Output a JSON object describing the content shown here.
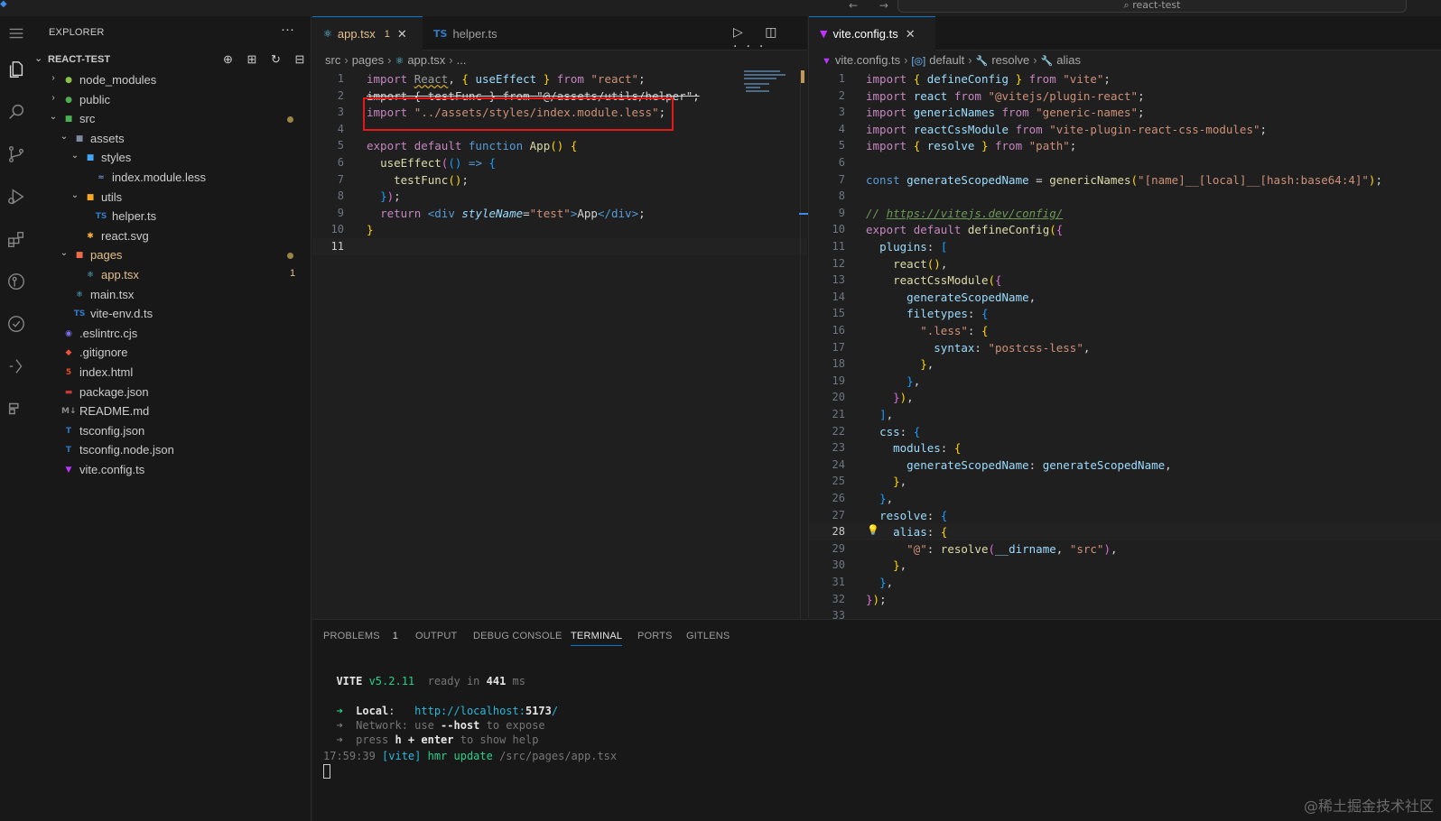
{
  "window": {
    "search_label": "react-test",
    "nav_arrows": "← →"
  },
  "activity_bar": {
    "items": [
      "explorer-icon",
      "search-icon",
      "source-control-icon",
      "run-debug-icon",
      "extensions-icon",
      "gitlens-icon",
      "remote-icon",
      "testing-icon",
      "timeline-icon"
    ]
  },
  "explorer": {
    "title": "EXPLORER",
    "more": "···",
    "project": "REACT-TEST",
    "actions": "⊕ ⊞ ↻ ⊟",
    "tree": [
      {
        "name": "node_modules",
        "depth": 0,
        "type": "folder",
        "open": false,
        "icon": "node-folder-icon"
      },
      {
        "name": "public",
        "depth": 0,
        "type": "folder",
        "open": false,
        "icon": "public-folder-icon"
      },
      {
        "name": "src",
        "depth": 0,
        "type": "folder",
        "open": true,
        "icon": "src-folder-icon",
        "dot": true
      },
      {
        "name": "assets",
        "depth": 1,
        "type": "folder",
        "open": true,
        "icon": "assets-folder-icon"
      },
      {
        "name": "styles",
        "depth": 2,
        "type": "folder",
        "open": true,
        "icon": "styles-folder-icon"
      },
      {
        "name": "index.module.less",
        "depth": 3,
        "type": "file",
        "icon": "less-file-icon"
      },
      {
        "name": "utils",
        "depth": 2,
        "type": "folder",
        "open": true,
        "icon": "utils-folder-icon"
      },
      {
        "name": "helper.ts",
        "depth": 3,
        "type": "file",
        "icon": "ts-file-icon"
      },
      {
        "name": "react.svg",
        "depth": 2,
        "type": "file",
        "icon": "svg-file-icon"
      },
      {
        "name": "pages",
        "depth": 1,
        "type": "folder",
        "open": true,
        "icon": "pages-folder-icon",
        "dot": true,
        "modified": true
      },
      {
        "name": "app.tsx",
        "depth": 2,
        "type": "file",
        "icon": "react-file-icon",
        "badge": "1",
        "modified": true
      },
      {
        "name": "main.tsx",
        "depth": 1,
        "type": "file",
        "icon": "react-file-icon"
      },
      {
        "name": "vite-env.d.ts",
        "depth": 1,
        "type": "file",
        "icon": "ts-file-icon"
      },
      {
        "name": ".eslintrc.cjs",
        "depth": 0,
        "type": "file",
        "icon": "eslint-file-icon"
      },
      {
        "name": ".gitignore",
        "depth": 0,
        "type": "file",
        "icon": "git-file-icon"
      },
      {
        "name": "index.html",
        "depth": 0,
        "type": "file",
        "icon": "html-file-icon"
      },
      {
        "name": "package.json",
        "depth": 0,
        "type": "file",
        "icon": "npm-file-icon"
      },
      {
        "name": "README.md",
        "depth": 0,
        "type": "file",
        "icon": "markdown-file-icon"
      },
      {
        "name": "tsconfig.json",
        "depth": 0,
        "type": "file",
        "icon": "tsconfig-file-icon"
      },
      {
        "name": "tsconfig.node.json",
        "depth": 0,
        "type": "file",
        "icon": "tsconfig-file-icon"
      },
      {
        "name": "vite.config.ts",
        "depth": 0,
        "type": "file",
        "icon": "vite-file-icon"
      }
    ]
  },
  "editor_left": {
    "tabs": [
      {
        "label": "app.tsx",
        "badge": "1",
        "close": "✕",
        "active": true,
        "icon": "react-file-icon"
      },
      {
        "label": "helper.ts",
        "active": false,
        "icon": "ts-file-icon"
      }
    ],
    "actions": "▷ ◫ ···",
    "breadcrumb": [
      "src",
      "pages",
      "app.tsx",
      "..."
    ],
    "code": [
      [
        [
          "kc",
          "import "
        ],
        [
          "unused",
          "React"
        ],
        [
          "p",
          ", "
        ],
        [
          "br1",
          "{"
        ],
        [
          "v",
          " useEffect "
        ],
        [
          "br1",
          "}"
        ],
        [
          "kc",
          " from "
        ],
        [
          "s",
          "\"react\""
        ],
        [
          "p",
          ";"
        ]
      ],
      [
        [
          "strike",
          "import { testFunc } from \"@/assets/utils/helper\";"
        ]
      ],
      [
        [
          "kc",
          "import "
        ],
        [
          "s",
          "\"../assets/styles/index.module.less\""
        ],
        [
          "p",
          ";"
        ]
      ],
      [],
      [
        [
          "kc",
          "export "
        ],
        [
          "kc",
          "default "
        ],
        [
          "k",
          "function "
        ],
        [
          "f",
          "App"
        ],
        [
          "br1",
          "()"
        ],
        [
          "p",
          " "
        ],
        [
          "br1",
          "{"
        ]
      ],
      [
        [
          "p",
          "  "
        ],
        [
          "f",
          "useEffect"
        ],
        [
          "br2",
          "("
        ],
        [
          "br3",
          "()"
        ],
        [
          "k",
          " => "
        ],
        [
          "br3",
          "{"
        ]
      ],
      [
        [
          "p",
          "    "
        ],
        [
          "f",
          "testFunc"
        ],
        [
          "br1",
          "()"
        ],
        [
          "p",
          ";"
        ]
      ],
      [
        [
          "p",
          "  "
        ],
        [
          "br3",
          "}"
        ],
        [
          "br2",
          ")"
        ],
        [
          "p",
          ";"
        ]
      ],
      [
        [
          "p",
          "  "
        ],
        [
          "kc",
          "return "
        ],
        [
          "tg",
          "<"
        ],
        [
          "tg",
          "div "
        ],
        [
          "attr",
          "styleName"
        ],
        [
          "p",
          "="
        ],
        [
          "s",
          "\"test\""
        ],
        [
          "tg",
          ">"
        ],
        [
          "txt",
          "App"
        ],
        [
          "tg",
          "</"
        ],
        [
          "tg",
          "div"
        ],
        [
          "tg",
          ">"
        ],
        [
          "p",
          ";"
        ]
      ],
      [
        [
          "br1",
          "}"
        ]
      ],
      []
    ],
    "current_line": 11
  },
  "editor_right": {
    "tabs": [
      {
        "label": "vite.config.ts",
        "close": "✕",
        "active": true,
        "icon": "vite-file-icon"
      }
    ],
    "breadcrumb": [
      "vite.config.ts",
      "default",
      "resolve",
      "alias"
    ],
    "code": [
      [
        [
          "kc",
          "import "
        ],
        [
          "br1",
          "{"
        ],
        [
          "v",
          " defineConfig "
        ],
        [
          "br1",
          "}"
        ],
        [
          "kc",
          " from "
        ],
        [
          "s",
          "\"vite\""
        ],
        [
          "p",
          ";"
        ]
      ],
      [
        [
          "kc",
          "import "
        ],
        [
          "v",
          "react"
        ],
        [
          "kc",
          " from "
        ],
        [
          "s",
          "\"@vitejs/plugin-react\""
        ],
        [
          "p",
          ";"
        ]
      ],
      [
        [
          "kc",
          "import "
        ],
        [
          "v",
          "genericNames"
        ],
        [
          "kc",
          " from "
        ],
        [
          "s",
          "\"generic-names\""
        ],
        [
          "p",
          ";"
        ]
      ],
      [
        [
          "kc",
          "import "
        ],
        [
          "v",
          "reactCssModule"
        ],
        [
          "kc",
          " from "
        ],
        [
          "s",
          "\"vite-plugin-react-css-modules\""
        ],
        [
          "p",
          ";"
        ]
      ],
      [
        [
          "kc",
          "import "
        ],
        [
          "br1",
          "{"
        ],
        [
          "v",
          " resolve "
        ],
        [
          "br1",
          "}"
        ],
        [
          "kc",
          " from "
        ],
        [
          "s",
          "\"path\""
        ],
        [
          "p",
          ";"
        ]
      ],
      [],
      [
        [
          "k",
          "const "
        ],
        [
          "v",
          "generateScopedName"
        ],
        [
          "p",
          " = "
        ],
        [
          "f",
          "genericNames"
        ],
        [
          "br1",
          "("
        ],
        [
          "s",
          "\"[name]__[local]__[hash:base64:4]\""
        ],
        [
          "br1",
          ")"
        ],
        [
          "p",
          ";"
        ]
      ],
      [],
      [
        [
          "cm",
          "// "
        ],
        [
          "cml",
          "https://vitejs.dev/config/"
        ]
      ],
      [
        [
          "kc",
          "export "
        ],
        [
          "kc",
          "default "
        ],
        [
          "f",
          "defineConfig"
        ],
        [
          "br1",
          "("
        ],
        [
          "br2",
          "{"
        ]
      ],
      [
        [
          "p",
          "  "
        ],
        [
          "v",
          "plugins"
        ],
        [
          "p",
          ": "
        ],
        [
          "br3",
          "["
        ]
      ],
      [
        [
          "p",
          "    "
        ],
        [
          "f",
          "react"
        ],
        [
          "br1",
          "()"
        ],
        [
          "p",
          ","
        ]
      ],
      [
        [
          "p",
          "    "
        ],
        [
          "f",
          "reactCssModule"
        ],
        [
          "br1",
          "("
        ],
        [
          "br2",
          "{"
        ]
      ],
      [
        [
          "p",
          "      "
        ],
        [
          "v",
          "generateScopedName"
        ],
        [
          "p",
          ","
        ]
      ],
      [
        [
          "p",
          "      "
        ],
        [
          "v",
          "filetypes"
        ],
        [
          "p",
          ": "
        ],
        [
          "br3",
          "{"
        ]
      ],
      [
        [
          "p",
          "        "
        ],
        [
          "s",
          "\".less\""
        ],
        [
          "p",
          ": "
        ],
        [
          "br1",
          "{"
        ]
      ],
      [
        [
          "p",
          "          "
        ],
        [
          "v",
          "syntax"
        ],
        [
          "p",
          ": "
        ],
        [
          "s",
          "\"postcss-less\""
        ],
        [
          "p",
          ","
        ]
      ],
      [
        [
          "p",
          "        "
        ],
        [
          "br1",
          "}"
        ],
        [
          "p",
          ","
        ]
      ],
      [
        [
          "p",
          "      "
        ],
        [
          "br3",
          "}"
        ],
        [
          "p",
          ","
        ]
      ],
      [
        [
          "p",
          "    "
        ],
        [
          "br2",
          "}"
        ],
        [
          "br1",
          ")"
        ],
        [
          "p",
          ","
        ]
      ],
      [
        [
          "p",
          "  "
        ],
        [
          "br3",
          "]"
        ],
        [
          "p",
          ","
        ]
      ],
      [
        [
          "p",
          "  "
        ],
        [
          "v",
          "css"
        ],
        [
          "p",
          ": "
        ],
        [
          "br3",
          "{"
        ]
      ],
      [
        [
          "p",
          "    "
        ],
        [
          "v",
          "modules"
        ],
        [
          "p",
          ": "
        ],
        [
          "br1",
          "{"
        ]
      ],
      [
        [
          "p",
          "      "
        ],
        [
          "v",
          "generateScopedName"
        ],
        [
          "p",
          ": "
        ],
        [
          "v",
          "generateScopedName"
        ],
        [
          "p",
          ","
        ]
      ],
      [
        [
          "p",
          "    "
        ],
        [
          "br1",
          "}"
        ],
        [
          "p",
          ","
        ]
      ],
      [
        [
          "p",
          "  "
        ],
        [
          "br3",
          "}"
        ],
        [
          "p",
          ","
        ]
      ],
      [
        [
          "p",
          "  "
        ],
        [
          "v",
          "resolve"
        ],
        [
          "p",
          ": "
        ],
        [
          "br3",
          "{"
        ]
      ],
      [
        [
          "p",
          "    "
        ],
        [
          "v",
          "alias"
        ],
        [
          "p",
          ": "
        ],
        [
          "br1",
          "{"
        ]
      ],
      [
        [
          "p",
          "      "
        ],
        [
          "s",
          "\"@\""
        ],
        [
          "p",
          ": "
        ],
        [
          "f",
          "resolve"
        ],
        [
          "br2",
          "("
        ],
        [
          "v",
          "__dirname"
        ],
        [
          "p",
          ", "
        ],
        [
          "s",
          "\"src\""
        ],
        [
          "br2",
          ")"
        ],
        [
          "p",
          ","
        ]
      ],
      [
        [
          "p",
          "    "
        ],
        [
          "br1",
          "}"
        ],
        [
          "p",
          ","
        ]
      ],
      [
        [
          "p",
          "  "
        ],
        [
          "br3",
          "}"
        ],
        [
          "p",
          ","
        ]
      ],
      [
        [
          "br2",
          "}"
        ],
        [
          "br1",
          ")"
        ],
        [
          "p",
          ";"
        ]
      ],
      []
    ],
    "current_line": 28
  },
  "panel": {
    "tabs": [
      {
        "label": "PROBLEMS",
        "badge": "1",
        "active": false
      },
      {
        "label": "OUTPUT",
        "active": false
      },
      {
        "label": "DEBUG CONSOLE",
        "active": false
      },
      {
        "label": "TERMINAL",
        "active": true
      },
      {
        "label": "PORTS",
        "active": false
      },
      {
        "label": "GITLENS",
        "active": false
      }
    ],
    "terminal": [
      [
        [
          "twhite",
          "  VITE"
        ],
        [
          "tgreen",
          " v5.2.11"
        ],
        [
          "tgray",
          "  ready in "
        ],
        [
          "twhite",
          "441"
        ],
        [
          "tgray",
          " ms"
        ]
      ],
      [],
      [
        [
          "tgreen",
          "  ➜  "
        ],
        [
          "twhite",
          "Local"
        ],
        [
          "tnorm",
          ":   "
        ],
        [
          "tcyan",
          "http://localhost:"
        ],
        [
          "twhite",
          "5173"
        ],
        [
          "tcyan",
          "/"
        ]
      ],
      [
        [
          "tgray",
          "  ➜  Network: use "
        ],
        [
          "twhite",
          "--host"
        ],
        [
          "tgray",
          " to expose"
        ]
      ],
      [
        [
          "tgray",
          "  ➜  press "
        ],
        [
          "twhite",
          "h + enter"
        ],
        [
          "tgray",
          " to show help"
        ]
      ],
      [
        [
          "tgray",
          "17:59:39"
        ],
        [
          "tcyan",
          " [vite]"
        ],
        [
          "tgreen",
          " hmr update"
        ],
        [
          "tgray",
          " /src/pages/app.tsx"
        ]
      ]
    ]
  },
  "watermark": "@稀土掘金技术社区",
  "colors": {
    "accent": "#0078d4",
    "highlight_box": "#e51919",
    "modified": "#e2c08d"
  }
}
